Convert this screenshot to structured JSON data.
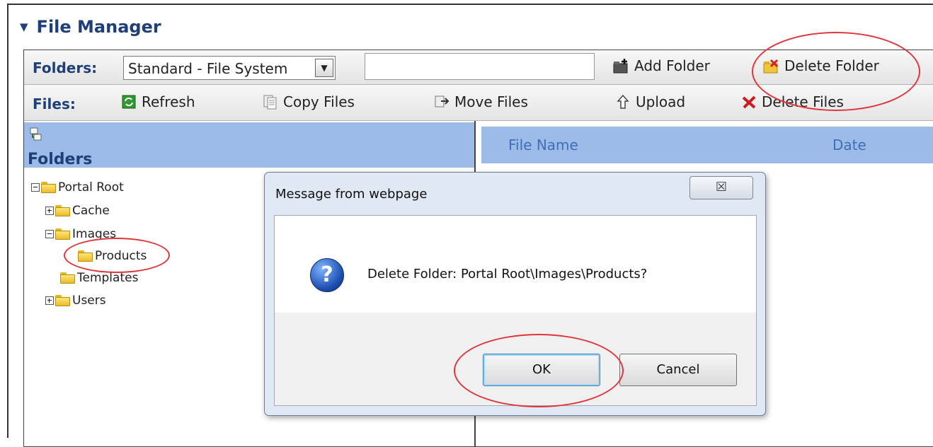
{
  "header": {
    "title": "File Manager"
  },
  "toolbar_folders": {
    "label": "Folders:",
    "select_value": "Standard - File System",
    "text_value": "",
    "add_folder": "Add Folder",
    "delete_folder": "Delete Folder"
  },
  "toolbar_files": {
    "label": "Files:",
    "refresh": "Refresh",
    "copy": "Copy Files",
    "move": "Move Files",
    "upload": "Upload",
    "delete": "Delete Files"
  },
  "folders_pane": {
    "header": "Folders"
  },
  "files_pane": {
    "col_name": "File Name",
    "col_date": "Date"
  },
  "tree": [
    {
      "label": "Portal Root",
      "expander": "minus"
    },
    {
      "label": "Cache",
      "expander": "plus"
    },
    {
      "label": "Images",
      "expander": "minus"
    },
    {
      "label": "Products",
      "expander": "none",
      "highlighted": true
    },
    {
      "label": "Templates",
      "expander": "none"
    },
    {
      "label": "Users",
      "expander": "plus"
    }
  ],
  "dialog": {
    "title": "Message from webpage",
    "close_glyph": "☒",
    "message": "Delete Folder: Portal Root\\Images\\Products?",
    "icon": "question-icon",
    "ok": "OK",
    "cancel": "Cancel"
  },
  "colors": {
    "accent": "#1e3f78",
    "header_blue": "#9dbbe8",
    "annotation": "#e0353a"
  }
}
